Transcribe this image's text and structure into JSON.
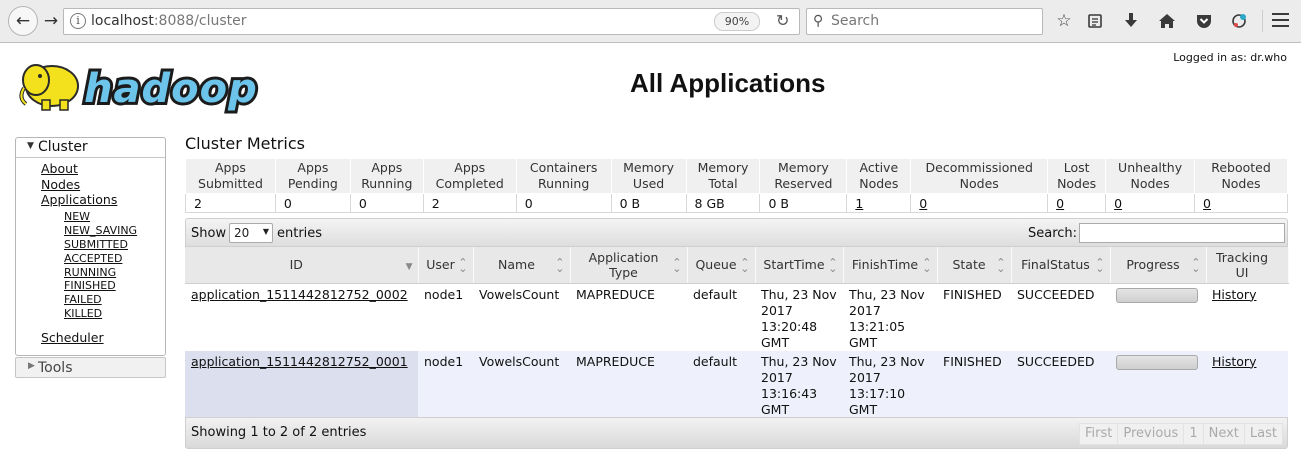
{
  "browser": {
    "url_host": "localhost",
    "url_rest": ":8088/cluster",
    "zoom": "90%",
    "search_placeholder": "Search"
  },
  "header": {
    "logged_in": "Logged in as: dr.who",
    "logo_text": "hadoop",
    "title": "All Applications"
  },
  "sidebar": {
    "cluster_label": "Cluster",
    "links": [
      "About",
      "Nodes",
      "Applications"
    ],
    "sub_links": [
      "NEW",
      "NEW_SAVING",
      "SUBMITTED",
      "ACCEPTED",
      "RUNNING",
      "FINISHED",
      "FAILED",
      "KILLED"
    ],
    "scheduler": "Scheduler",
    "tools_label": "Tools"
  },
  "metrics": {
    "title": "Cluster Metrics",
    "headers": [
      [
        "Apps",
        "Submitted"
      ],
      [
        "Apps",
        "Pending"
      ],
      [
        "Apps",
        "Running"
      ],
      [
        "Apps",
        "Completed"
      ],
      [
        "Containers",
        "Running"
      ],
      [
        "Memory",
        "Used"
      ],
      [
        "Memory",
        "Total"
      ],
      [
        "Memory",
        "Reserved"
      ],
      [
        "Active",
        "Nodes"
      ],
      [
        "Decommissioned",
        "Nodes"
      ],
      [
        "Lost",
        "Nodes"
      ],
      [
        "Unhealthy",
        "Nodes"
      ],
      [
        "Rebooted",
        "Nodes"
      ]
    ],
    "values": [
      "2",
      "0",
      "0",
      "2",
      "0",
      "0 B",
      "8 GB",
      "0 B",
      "1",
      "0",
      "0",
      "0",
      "0"
    ]
  },
  "apps": {
    "show_label": "Show",
    "entries_value": "20",
    "entries_label": "entries",
    "search_label": "Search:",
    "columns": [
      [
        "ID"
      ],
      [
        "User"
      ],
      [
        "Name"
      ],
      [
        "Application",
        "Type"
      ],
      [
        "Queue"
      ],
      [
        "StartTime"
      ],
      [
        "FinishTime"
      ],
      [
        "State"
      ],
      [
        "FinalStatus"
      ],
      [
        "Progress"
      ],
      [
        "Tracking",
        "UI"
      ]
    ],
    "rows": [
      {
        "id": "application_1511442812752_0002",
        "user": "node1",
        "name": "VowelsCount",
        "type": "MAPREDUCE",
        "queue": "default",
        "start": "Thu, 23 Nov 2017 13:20:48 GMT",
        "finish": "Thu, 23 Nov 2017 13:21:05 GMT",
        "state": "FINISHED",
        "final_status": "SUCCEEDED",
        "progress": 1.0,
        "tracking": "History"
      },
      {
        "id": "application_1511442812752_0001",
        "user": "node1",
        "name": "VowelsCount",
        "type": "MAPREDUCE",
        "queue": "default",
        "start": "Thu, 23 Nov 2017 13:16:43 GMT",
        "finish": "Thu, 23 Nov 2017 13:17:10 GMT",
        "state": "FINISHED",
        "final_status": "SUCCEEDED",
        "progress": 1.0,
        "tracking": "History"
      }
    ],
    "footer_info": "Showing 1 to 2 of 2 entries",
    "pager": [
      "First",
      "Previous",
      "1",
      "Next",
      "Last"
    ]
  }
}
